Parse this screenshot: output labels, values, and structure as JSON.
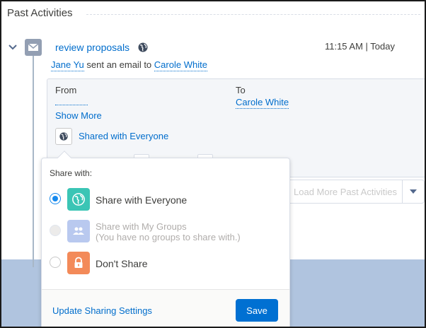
{
  "section": {
    "title": "Past Activities"
  },
  "activity": {
    "subject": "review proposals",
    "time": "11:15 AM | Today",
    "actor": "Jane Yu",
    "verb": "sent an email to",
    "recipient": "Carole White",
    "from_label": "From",
    "to_label": "To",
    "to_value": "Carole White",
    "show_more": "Show More",
    "shared_status": "Shared with Everyone"
  },
  "load_more": {
    "label": "Load More Past Activities"
  },
  "popover": {
    "heading": "Share with:",
    "options": [
      {
        "label": "Share with Everyone",
        "checked": true,
        "disabled": false,
        "icon": "globe-icon",
        "color": "#3bc5b5"
      },
      {
        "label": "Share with My Groups",
        "sublabel": "(You have no groups to share with.)",
        "checked": false,
        "disabled": true,
        "icon": "groups-icon",
        "color": "#b9c9ef"
      },
      {
        "label": "Don't Share",
        "checked": false,
        "disabled": false,
        "icon": "lock-icon",
        "color": "#f38a59"
      }
    ],
    "update_link": "Update Sharing Settings",
    "save_label": "Save"
  },
  "colors": {
    "link": "#006dcc",
    "brand": "#0070d2",
    "backdrop": "#b0c4df"
  }
}
